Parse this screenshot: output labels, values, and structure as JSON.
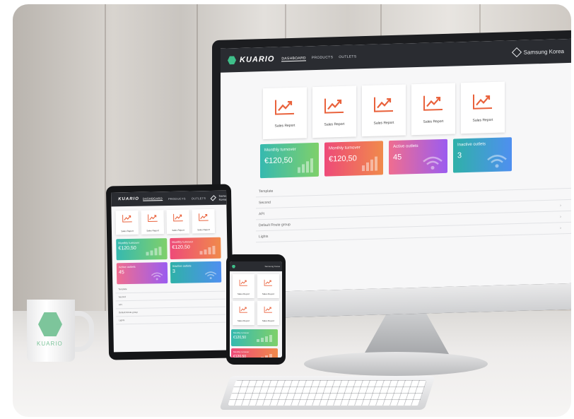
{
  "app": {
    "brand": "KUARIO",
    "nav": [
      "DASHBOARD",
      "PRODUCTS",
      "OUTLETS"
    ],
    "user": "Samsung Korea"
  },
  "tiles": [
    {
      "label": "Sales Report",
      "icon": "trending-up-icon"
    },
    {
      "label": "Sales Report",
      "icon": "trending-up-icon"
    },
    {
      "label": "Sales Report",
      "icon": "trending-up-icon"
    },
    {
      "label": "Sales Report",
      "icon": "trending-up-icon"
    },
    {
      "label": "Sales Report",
      "icon": "trending-up-icon"
    }
  ],
  "cards": [
    {
      "title": "Monthly turnover",
      "value": "€120,50",
      "gradient": [
        "#36b9b0",
        "#7fd06a"
      ],
      "deco": "bar-chart-icon"
    },
    {
      "title": "Monthly turnover",
      "value": "€120,50",
      "gradient": [
        "#ee4a79",
        "#f08a4b"
      ],
      "deco": "bar-chart-icon"
    },
    {
      "title": "Active outlets",
      "value": "45",
      "gradient": [
        "#f06d8f",
        "#9b5cf0"
      ],
      "deco": "wifi-icon"
    },
    {
      "title": "Inactive outlets",
      "value": "3",
      "gradient": [
        "#2fb1a8",
        "#4f8ff0"
      ],
      "deco": "wifi-icon"
    }
  ],
  "list": [
    "Template",
    "Second",
    "API",
    "Default Route group",
    "Lights"
  ],
  "mug": {
    "brand": "KUARIO"
  }
}
